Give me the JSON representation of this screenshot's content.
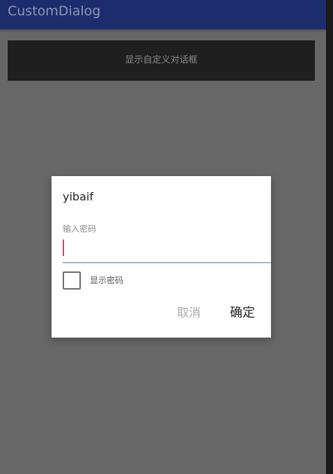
{
  "app_bar": {
    "title": "CustomDialog"
  },
  "main": {
    "show_dialog_button_label": "显示自定义对话框"
  },
  "dialog": {
    "title": "yibaif",
    "password_label": "输入密码",
    "password_value": "",
    "show_password_label": "显示密码",
    "show_password_checked": false,
    "cancel_label": "取消",
    "ok_label": "确定"
  },
  "colors": {
    "app_bar": "#1c2d6d",
    "scrim_background": "#676767",
    "input_underline": "#3f7fb7",
    "caret": "#e8387a"
  }
}
